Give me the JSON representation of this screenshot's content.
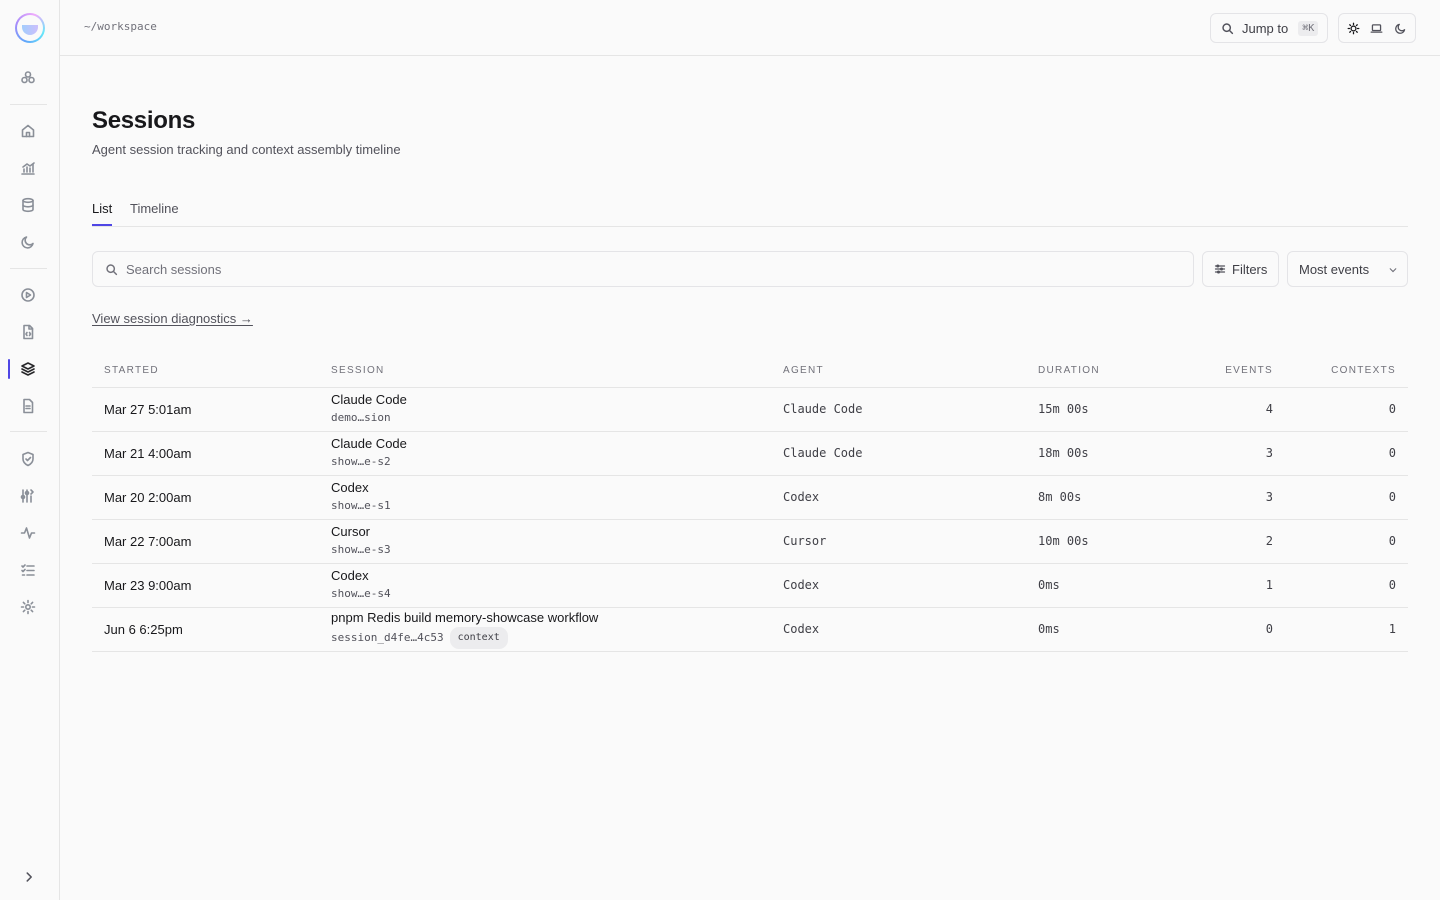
{
  "header": {
    "breadcrumb": "~/workspace",
    "jump_label": "Jump to",
    "jump_shortcut": "⌘K"
  },
  "sidebar": {
    "items": [
      {
        "icon": "components-icon"
      },
      {
        "icon": "home-icon"
      },
      {
        "icon": "analytics-icon"
      },
      {
        "icon": "database-icon"
      },
      {
        "icon": "moon-icon"
      },
      {
        "icon": "play-icon"
      },
      {
        "icon": "file-code-icon"
      },
      {
        "icon": "layers-icon",
        "active": true
      },
      {
        "icon": "document-icon"
      },
      {
        "icon": "shield-icon"
      },
      {
        "icon": "tools-icon"
      },
      {
        "icon": "activity-icon"
      },
      {
        "icon": "checklist-icon"
      },
      {
        "icon": "gear-icon"
      }
    ]
  },
  "page": {
    "title": "Sessions",
    "subtitle": "Agent session tracking and context assembly timeline",
    "tabs": [
      {
        "label": "List",
        "active": true
      },
      {
        "label": "Timeline",
        "active": false
      }
    ],
    "search_placeholder": "Search sessions",
    "filters_label": "Filters",
    "sort_label": "Most events",
    "diagnostics_link": "View session diagnostics →"
  },
  "table": {
    "columns": [
      "STARTED",
      "SESSION",
      "AGENT",
      "DURATION",
      "EVENTS",
      "CONTEXTS"
    ],
    "rows": [
      {
        "started": "Mar 27 5:01am",
        "name": "Claude Code",
        "id": "demo…sion",
        "badge": "",
        "agent": "Claude Code",
        "duration": "15m 00s",
        "events": "4",
        "contexts": "0"
      },
      {
        "started": "Mar 21 4:00am",
        "name": "Claude Code",
        "id": "show…e-s2",
        "badge": "",
        "agent": "Claude Code",
        "duration": "18m 00s",
        "events": "3",
        "contexts": "0"
      },
      {
        "started": "Mar 20 2:00am",
        "name": "Codex",
        "id": "show…e-s1",
        "badge": "",
        "agent": "Codex",
        "duration": "8m 00s",
        "events": "3",
        "contexts": "0"
      },
      {
        "started": "Mar 22 7:00am",
        "name": "Cursor",
        "id": "show…e-s3",
        "badge": "",
        "agent": "Cursor",
        "duration": "10m 00s",
        "events": "2",
        "contexts": "0"
      },
      {
        "started": "Mar 23 9:00am",
        "name": "Codex",
        "id": "show…e-s4",
        "badge": "",
        "agent": "Codex",
        "duration": "0ms",
        "events": "1",
        "contexts": "0"
      },
      {
        "started": "Jun 6 6:25pm",
        "name": "pnpm Redis build memory-showcase workflow",
        "id": "session_d4fe…4c53",
        "badge": "context",
        "agent": "Codex",
        "duration": "0ms",
        "events": "0",
        "contexts": "1"
      }
    ]
  },
  "colors": {
    "accent": "#4f46e5",
    "border": "#e5e5e5",
    "background": "#fafafa"
  }
}
